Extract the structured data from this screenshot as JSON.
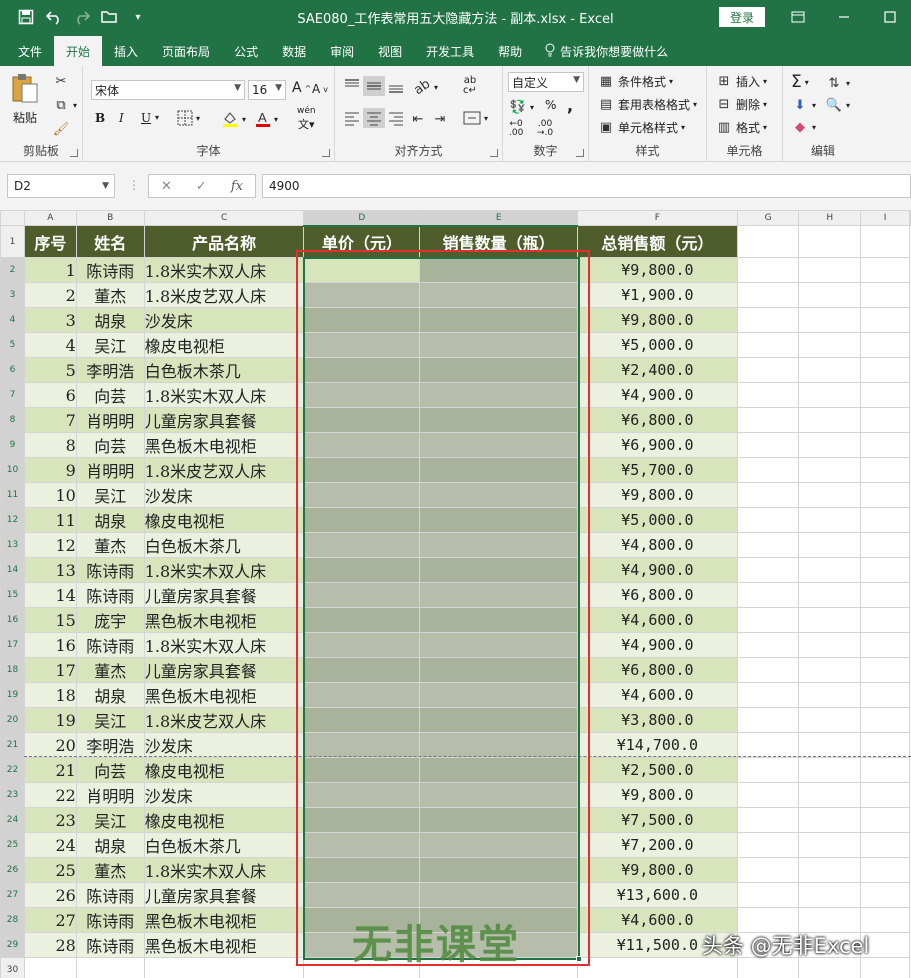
{
  "window": {
    "title": "SAE080_工作表常用五大隐藏方法 - 副本.xlsx  -  Excel",
    "login_label": "登录"
  },
  "qat": {
    "icons": [
      "save-icon",
      "undo-icon",
      "redo-icon",
      "open-icon",
      "customize-icon"
    ]
  },
  "ribbon_tabs": [
    "文件",
    "开始",
    "插入",
    "页面布局",
    "公式",
    "数据",
    "审阅",
    "视图",
    "开发工具",
    "帮助"
  ],
  "active_tab": "开始",
  "tell_me": "告诉我你想要做什么",
  "ribbon": {
    "clipboard": {
      "paste": "粘贴",
      "label": "剪贴板"
    },
    "font": {
      "name": "宋体",
      "size": "16",
      "bold": "B",
      "italic": "I",
      "underline": "U",
      "label": "字体",
      "phonetic": "wén"
    },
    "alignment": {
      "label": "对齐方式"
    },
    "number": {
      "format": "自定义",
      "percent": "%",
      "comma": ",",
      "label": "数字"
    },
    "styles": {
      "conditional": "条件格式",
      "table": "套用表格格式",
      "cell": "单元格样式",
      "label": "样式"
    },
    "cells": {
      "insert": "插入",
      "delete": "删除",
      "format": "格式",
      "label": "单元格"
    },
    "editing": {
      "label": "编辑"
    }
  },
  "formula_bar": {
    "name_box": "D2",
    "value": "4900",
    "fx": "fx"
  },
  "columns": [
    "A",
    "B",
    "C",
    "D",
    "E",
    "F",
    "G",
    "H",
    "I"
  ],
  "selected_columns": [
    "D",
    "E"
  ],
  "headers": [
    "序号",
    "姓名",
    "产品名称",
    "单价（元）",
    "销售数量（瓶）",
    "总销售额（元）"
  ],
  "rows": [
    {
      "n": "1",
      "name": "陈诗雨",
      "product": "1.8米实木双人床",
      "total": "¥9,800.0"
    },
    {
      "n": "2",
      "name": "董杰",
      "product": "1.8米皮艺双人床",
      "total": "¥1,900.0"
    },
    {
      "n": "3",
      "name": "胡泉",
      "product": "沙发床",
      "total": "¥9,800.0"
    },
    {
      "n": "4",
      "name": "吴江",
      "product": "橡皮电视柜",
      "total": "¥5,000.0"
    },
    {
      "n": "5",
      "name": "李明浩",
      "product": "白色板木茶几",
      "total": "¥2,400.0"
    },
    {
      "n": "6",
      "name": "向芸",
      "product": "1.8米实木双人床",
      "total": "¥4,900.0"
    },
    {
      "n": "7",
      "name": "肖明明",
      "product": "儿童房家具套餐",
      "total": "¥6,800.0"
    },
    {
      "n": "8",
      "name": "向芸",
      "product": "黑色板木电视柜",
      "total": "¥6,900.0"
    },
    {
      "n": "9",
      "name": "肖明明",
      "product": "1.8米皮艺双人床",
      "total": "¥5,700.0"
    },
    {
      "n": "10",
      "name": "吴江",
      "product": "沙发床",
      "total": "¥9,800.0"
    },
    {
      "n": "11",
      "name": "胡泉",
      "product": "橡皮电视柜",
      "total": "¥5,000.0"
    },
    {
      "n": "12",
      "name": "董杰",
      "product": "白色板木茶几",
      "total": "¥4,800.0"
    },
    {
      "n": "13",
      "name": "陈诗雨",
      "product": "1.8米实木双人床",
      "total": "¥4,900.0"
    },
    {
      "n": "14",
      "name": "陈诗雨",
      "product": "儿童房家具套餐",
      "total": "¥6,800.0"
    },
    {
      "n": "15",
      "name": "庞宇",
      "product": "黑色板木电视柜",
      "total": "¥4,600.0"
    },
    {
      "n": "16",
      "name": "陈诗雨",
      "product": "1.8米实木双人床",
      "total": "¥4,900.0"
    },
    {
      "n": "17",
      "name": "董杰",
      "product": "儿童房家具套餐",
      "total": "¥6,800.0"
    },
    {
      "n": "18",
      "name": "胡泉",
      "product": "黑色板木电视柜",
      "total": "¥4,600.0"
    },
    {
      "n": "19",
      "name": "吴江",
      "product": "1.8米皮艺双人床",
      "total": "¥3,800.0"
    },
    {
      "n": "20",
      "name": "李明浩",
      "product": "沙发床",
      "total": "¥14,700.0"
    },
    {
      "n": "21",
      "name": "向芸",
      "product": "橡皮电视柜",
      "total": "¥2,500.0"
    },
    {
      "n": "22",
      "name": "肖明明",
      "product": "沙发床",
      "total": "¥9,800.0"
    },
    {
      "n": "23",
      "name": "吴江",
      "product": "橡皮电视柜",
      "total": "¥7,500.0"
    },
    {
      "n": "24",
      "name": "胡泉",
      "product": "白色板木茶几",
      "total": "¥7,200.0"
    },
    {
      "n": "25",
      "name": "董杰",
      "product": "1.8米实木双人床",
      "total": "¥9,800.0"
    },
    {
      "n": "26",
      "name": "陈诗雨",
      "product": "儿童房家具套餐",
      "total": "¥13,600.0"
    },
    {
      "n": "27",
      "name": "陈诗雨",
      "product": "黑色板木电视柜",
      "total": "¥4,600.0"
    },
    {
      "n": "28",
      "name": "陈诗雨",
      "product": "黑色板木电视柜",
      "total": "¥11,500.0"
    }
  ],
  "watermark": "无非课堂",
  "credit": "头条 @无非Excel",
  "colors": {
    "excel_green": "#217346",
    "header_fill": "#4e5d2b",
    "band_a": "#d8e4bc",
    "band_b": "#ebf1de",
    "highlight_box": "#e03030"
  }
}
